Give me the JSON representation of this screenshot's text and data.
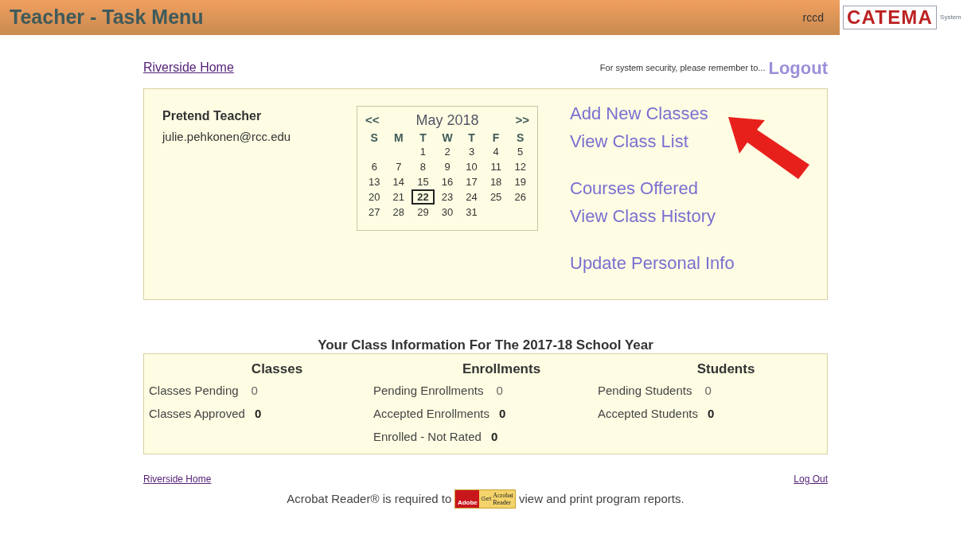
{
  "header": {
    "title": "Teacher - Task Menu",
    "user": "rccd",
    "logo": {
      "text": "CATEMA",
      "sub": "System"
    }
  },
  "top": {
    "home_link": "Riverside Home",
    "security_note": "For system security, please remember to...",
    "logout": "Logout"
  },
  "profile": {
    "name": "Pretend Teacher",
    "email": "julie.pehkonen@rcc.edu"
  },
  "calendar": {
    "prev": "<<",
    "month": "May 2018",
    "next": ">>",
    "weekdays": [
      "S",
      "M",
      "T",
      "W",
      "T",
      "F",
      "S"
    ],
    "weeks": [
      [
        {
          "day": "1",
          "selected": false
        },
        {
          "day": "2",
          "selected": false
        },
        {
          "day": "3",
          "selected": false
        },
        {
          "day": "4",
          "selected": false
        },
        {
          "day": "5",
          "selected": false
        }
      ],
      [
        {
          "day": "6",
          "selected": false
        },
        {
          "day": "7",
          "selected": false
        },
        {
          "day": "8",
          "selected": false
        },
        {
          "day": "9",
          "selected": false
        },
        {
          "day": "10",
          "selected": false
        },
        {
          "day": "11",
          "selected": false
        },
        {
          "day": "12",
          "selected": false
        }
      ],
      [
        {
          "day": "13",
          "selected": false
        },
        {
          "day": "14",
          "selected": false
        },
        {
          "day": "15",
          "selected": false
        },
        {
          "day": "16",
          "selected": false
        },
        {
          "day": "17",
          "selected": false
        },
        {
          "day": "18",
          "selected": false
        },
        {
          "day": "19",
          "selected": false
        }
      ],
      [
        {
          "day": "20",
          "selected": false
        },
        {
          "day": "21",
          "selected": false
        },
        {
          "day": "22",
          "selected": true
        },
        {
          "day": "23",
          "selected": false
        },
        {
          "day": "24",
          "selected": false
        },
        {
          "day": "25",
          "selected": false
        },
        {
          "day": "26",
          "selected": false
        }
      ],
      [
        {
          "day": "27",
          "selected": false
        },
        {
          "day": "28",
          "selected": false
        },
        {
          "day": "29",
          "selected": false
        },
        {
          "day": "30",
          "selected": false
        },
        {
          "day": "31",
          "selected": false
        }
      ]
    ]
  },
  "task_links": [
    [
      "Add New Classes",
      "View Class List"
    ],
    [
      "Courses Offered",
      "View Class History"
    ],
    [
      "Update Personal Info"
    ]
  ],
  "class_info": {
    "title": "Your Class Information For The 2017-18 School Year",
    "columns": [
      {
        "heading": "Classes",
        "rows": [
          {
            "label": "Classes Pending",
            "value": "0",
            "bold": false
          },
          {
            "label": "Classes Approved",
            "value": "0",
            "bold": true
          }
        ]
      },
      {
        "heading": "Enrollments",
        "rows": [
          {
            "label": "Pending Enrollments",
            "value": "0",
            "bold": false
          },
          {
            "label": "Accepted Enrollments",
            "value": "0",
            "bold": true
          },
          {
            "label": "Enrolled - Not Rated",
            "value": "0",
            "bold": true
          }
        ]
      },
      {
        "heading": "Students",
        "rows": [
          {
            "label": "Pending Students",
            "value": "0",
            "bold": false
          },
          {
            "label": "Accepted Students",
            "value": "0",
            "bold": true
          }
        ]
      }
    ]
  },
  "footer": {
    "home_link": "Riverside Home",
    "logout_link": "Log Out",
    "note_before": "Acrobat Reader® is required to",
    "badge": {
      "adobe": "Adobe",
      "get": "Get",
      "line1": "Acrobat",
      "line2": "Reader"
    },
    "note_after": "view and print program reports."
  }
}
